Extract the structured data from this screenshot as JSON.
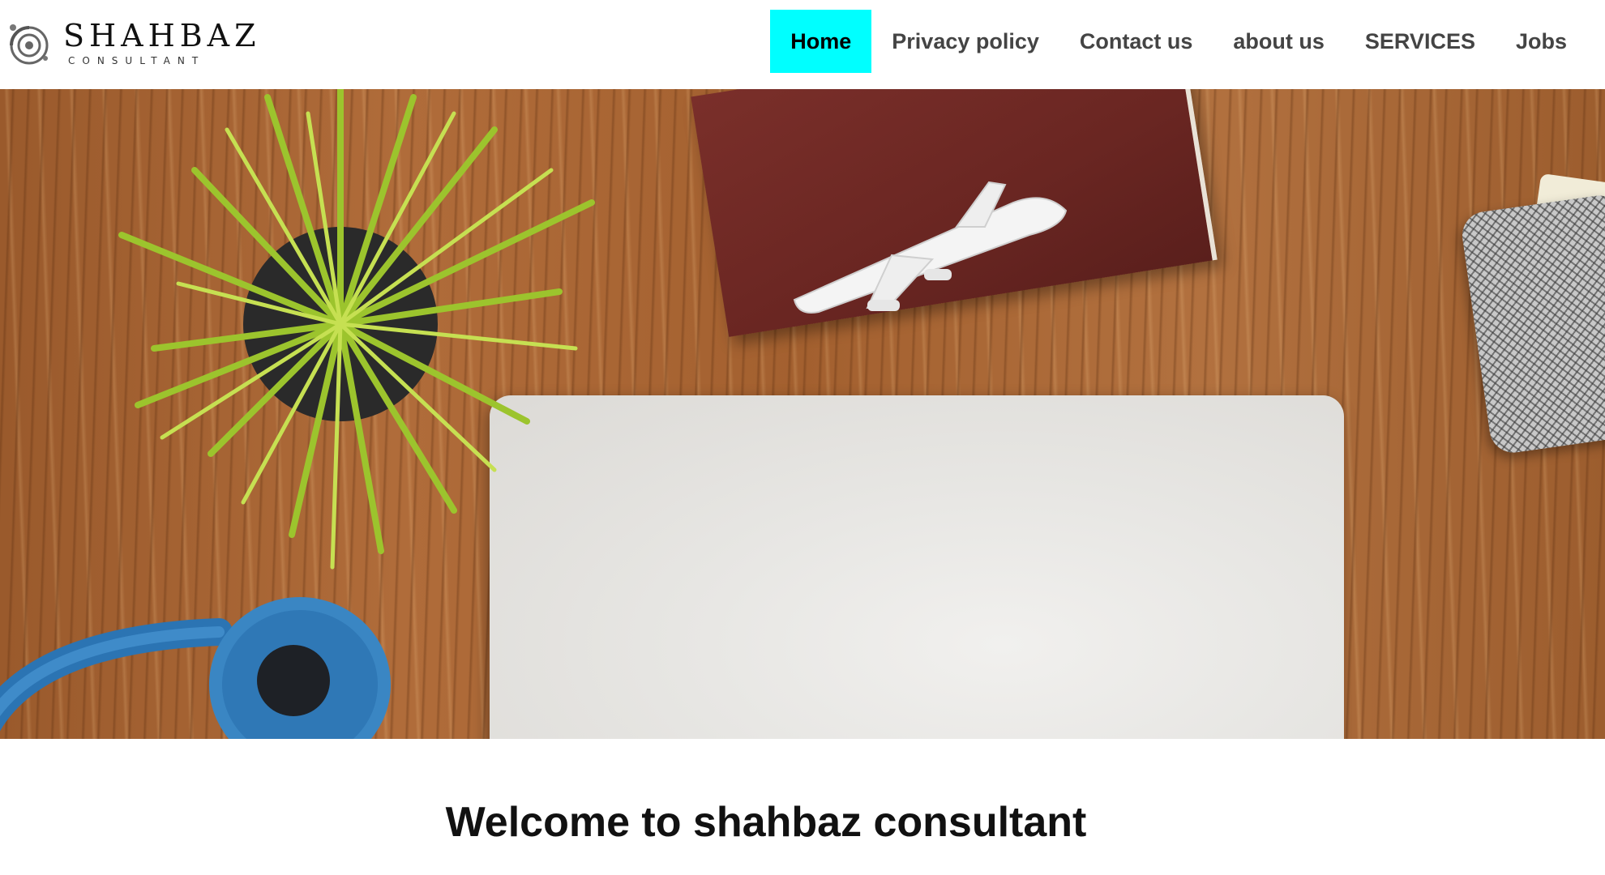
{
  "brand": {
    "name": "SHAHBAZ",
    "tagline": "CONSULTANT",
    "logo_icon": "orbit-logo-icon"
  },
  "nav": {
    "items": [
      {
        "label": "Home",
        "active": true
      },
      {
        "label": "Privacy policy",
        "active": false
      },
      {
        "label": "Contact us",
        "active": false
      },
      {
        "label": "about us",
        "active": false
      },
      {
        "label": "SERVICES",
        "active": false
      },
      {
        "label": "Jobs",
        "active": false
      }
    ],
    "active_color": "#00ffff"
  },
  "hero": {
    "scene": [
      "wood-desk",
      "potted-plant",
      "blue-headphones",
      "closed-laptop",
      "red-notebook",
      "toy-airplane",
      "mesh-pencil-cup"
    ]
  },
  "welcome": {
    "heading": "Welcome to shahbaz consultant"
  }
}
